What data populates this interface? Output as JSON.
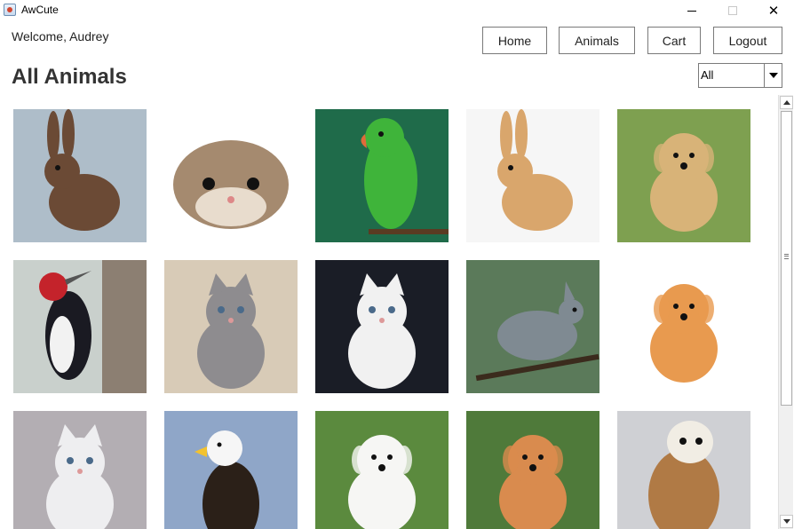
{
  "window": {
    "title": "AwCute",
    "minimize_icon": "minimize-icon",
    "maximize_icon": "maximize-icon",
    "close_icon": "close-icon",
    "close_glyph": "✕"
  },
  "header": {
    "welcome": "Welcome, Audrey",
    "nav": {
      "home": "Home",
      "animals": "Animals",
      "cart": "Cart",
      "logout": "Logout"
    }
  },
  "main": {
    "title": "All Animals",
    "filter": {
      "selected": "All"
    }
  },
  "animals": [
    {
      "kind": "rabbit",
      "bg": "#aebdc9",
      "body": "#6b4a35"
    },
    {
      "kind": "hamster",
      "bg": "#ffffff",
      "body": "#a58a6f"
    },
    {
      "kind": "parrot",
      "bg": "#1f6b4a",
      "body": "#3fb43a"
    },
    {
      "kind": "rabbit",
      "bg": "#f6f6f6",
      "body": "#d9a66c"
    },
    {
      "kind": "dog",
      "bg": "#7ea050",
      "body": "#d8b378"
    },
    {
      "kind": "woodpecker",
      "bg": "#c9d0cc",
      "body": "#1a1a22"
    },
    {
      "kind": "cat",
      "bg": "#d8cbb7",
      "body": "#8e8c8f"
    },
    {
      "kind": "cat",
      "bg": "#1a1d26",
      "body": "#f1f1f1"
    },
    {
      "kind": "bird",
      "bg": "#5b7a5a",
      "body": "#7f8a92"
    },
    {
      "kind": "dog",
      "bg": "#ffffff",
      "body": "#e89a4f"
    },
    {
      "kind": "cat",
      "bg": "#b3aeb3",
      "body": "#eeeef0"
    },
    {
      "kind": "eagle",
      "bg": "#8fa6c8",
      "body": "#2b2018"
    },
    {
      "kind": "dog",
      "bg": "#5b8a3e",
      "body": "#f6f6f4"
    },
    {
      "kind": "dog",
      "bg": "#4f7a3a",
      "body": "#d98b4e"
    },
    {
      "kind": "owl",
      "bg": "#cfd0d4",
      "body": "#b07a45"
    }
  ]
}
